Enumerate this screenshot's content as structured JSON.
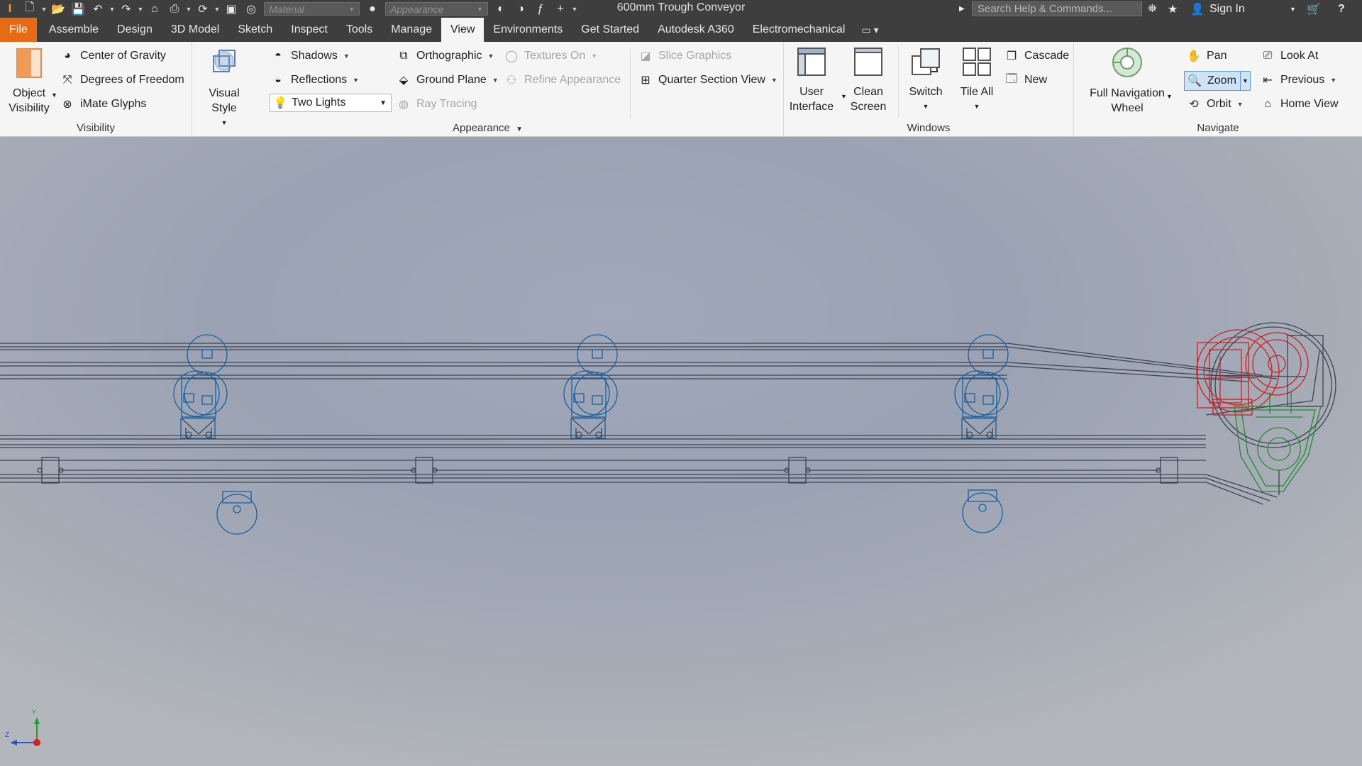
{
  "titlebar": {
    "material_placeholder": "Material",
    "appearance_placeholder": "Appearance",
    "document_title": "600mm Trough Conveyor",
    "search_placeholder": "Search Help & Commands...",
    "sign_in": "Sign In"
  },
  "tabs": {
    "file": "File",
    "items": [
      "Assemble",
      "Design",
      "3D Model",
      "Sketch",
      "Inspect",
      "Tools",
      "Manage",
      "View",
      "Environments",
      "Get Started",
      "Autodesk A360",
      "Electromechanical"
    ],
    "active": "View"
  },
  "ribbon": {
    "visibility": {
      "title": "Visibility",
      "object_visibility": "Object",
      "object_visibility_2": "Visibility",
      "center_of_gravity": "Center of Gravity",
      "degrees_of_freedom": "Degrees of Freedom",
      "imate_glyphs": "iMate Glyphs"
    },
    "appearance": {
      "title": "Appearance",
      "visual_style": "Visual Style",
      "shadows": "Shadows",
      "reflections": "Reflections",
      "lighting": "Two Lights",
      "orthographic": "Orthographic",
      "ground_plane": "Ground Plane",
      "ray_tracing": "Ray Tracing",
      "textures_on": "Textures On",
      "refine_appearance": "Refine Appearance",
      "slice_graphics": "Slice Graphics",
      "quarter_section_view": "Quarter Section View"
    },
    "windows": {
      "title": "Windows",
      "user_interface": "User",
      "user_interface_2": "Interface",
      "clean_screen": "Clean",
      "clean_screen_2": "Screen",
      "switch": "Switch",
      "tile_all": "Tile All",
      "cascade": "Cascade",
      "new": "New"
    },
    "navigate": {
      "title": "Navigate",
      "full_nav_wheel": "Full Navigation",
      "full_nav_wheel_2": "Wheel",
      "pan": "Pan",
      "zoom": "Zoom",
      "orbit": "Orbit",
      "look_at": "Look At",
      "previous": "Previous",
      "home_view": "Home View"
    }
  },
  "triad": {
    "y": "Y",
    "z": "Z"
  },
  "colors": {
    "file_tab": "#e96a14",
    "titlebar": "#3e3e3f",
    "wire_blue": "#1a5f9e",
    "wire_red": "#cc1f1f",
    "wire_green": "#1f8f2a"
  }
}
